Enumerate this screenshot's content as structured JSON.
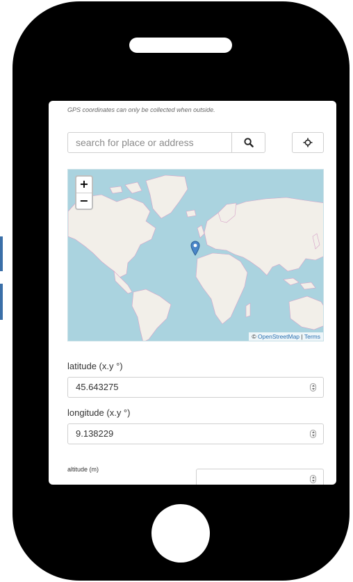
{
  "form": {
    "hint": "GPS coordinates can only be collected when outside.",
    "search": {
      "placeholder": "search for place or address",
      "search_icon": "search-icon",
      "locate_icon": "crosshair-icon"
    },
    "map": {
      "zoom_in": "+",
      "zoom_out": "−",
      "attribution_prefix": "©",
      "attribution_link": "OpenStreetMap",
      "attribution_sep": "|",
      "attribution_terms": "Terms",
      "colors": {
        "water": "#aad3df",
        "land": "#f2efe9",
        "border": "#d6a1c8",
        "marker": "#4a86c8"
      }
    },
    "latitude": {
      "label": "latitude (x.y °)",
      "value": "45.643275"
    },
    "longitude": {
      "label": "longitude (x.y °)",
      "value": "9.138229"
    },
    "altitude": {
      "label": "altitude (m)",
      "value": ""
    }
  }
}
